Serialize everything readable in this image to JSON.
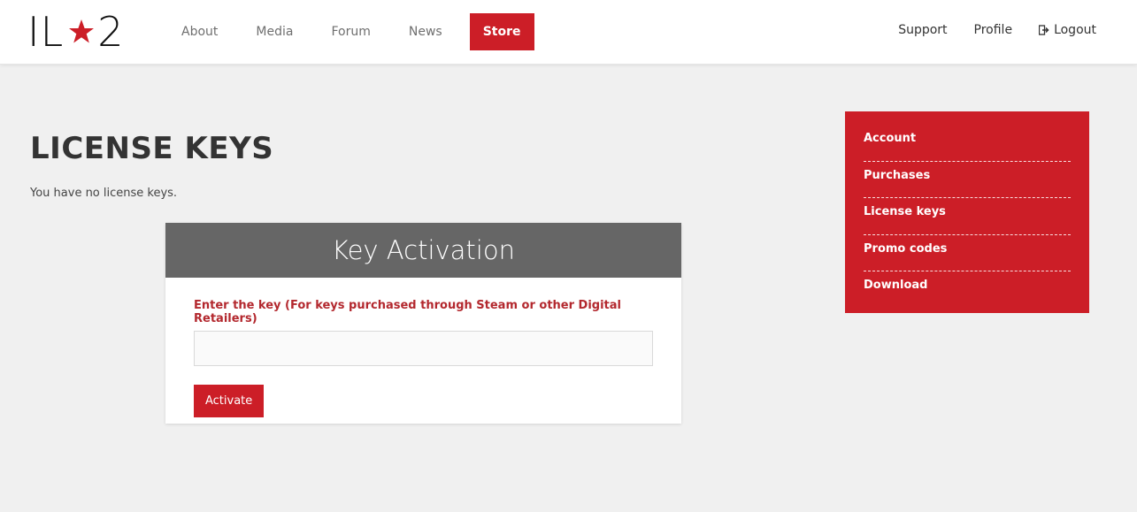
{
  "header": {
    "logo": {
      "left": "IL",
      "right": "2",
      "icon": "star-icon"
    },
    "nav": [
      {
        "label": "About"
      },
      {
        "label": "Media"
      },
      {
        "label": "Forum"
      },
      {
        "label": "News"
      },
      {
        "label": "Store"
      }
    ],
    "right_nav": {
      "support": "Support",
      "profile": "Profile",
      "logout": "Logout",
      "logout_icon": "logout-icon"
    }
  },
  "colors": {
    "accent": "#cc1e27",
    "card_header": "#666666",
    "label": "#b3282e",
    "background": "#f0f0f0"
  },
  "main": {
    "title": "LICENSE KEYS",
    "empty_text": "You have no license keys."
  },
  "activation": {
    "title": "Key Activation",
    "label": "Enter the key (For keys purchased through Steam or other Digital Retailers)",
    "input_value": "",
    "button": "Activate"
  },
  "sidebar": {
    "items": [
      {
        "label": "Account"
      },
      {
        "label": "Purchases"
      },
      {
        "label": "License keys"
      },
      {
        "label": "Promo codes"
      },
      {
        "label": "Download"
      }
    ]
  }
}
